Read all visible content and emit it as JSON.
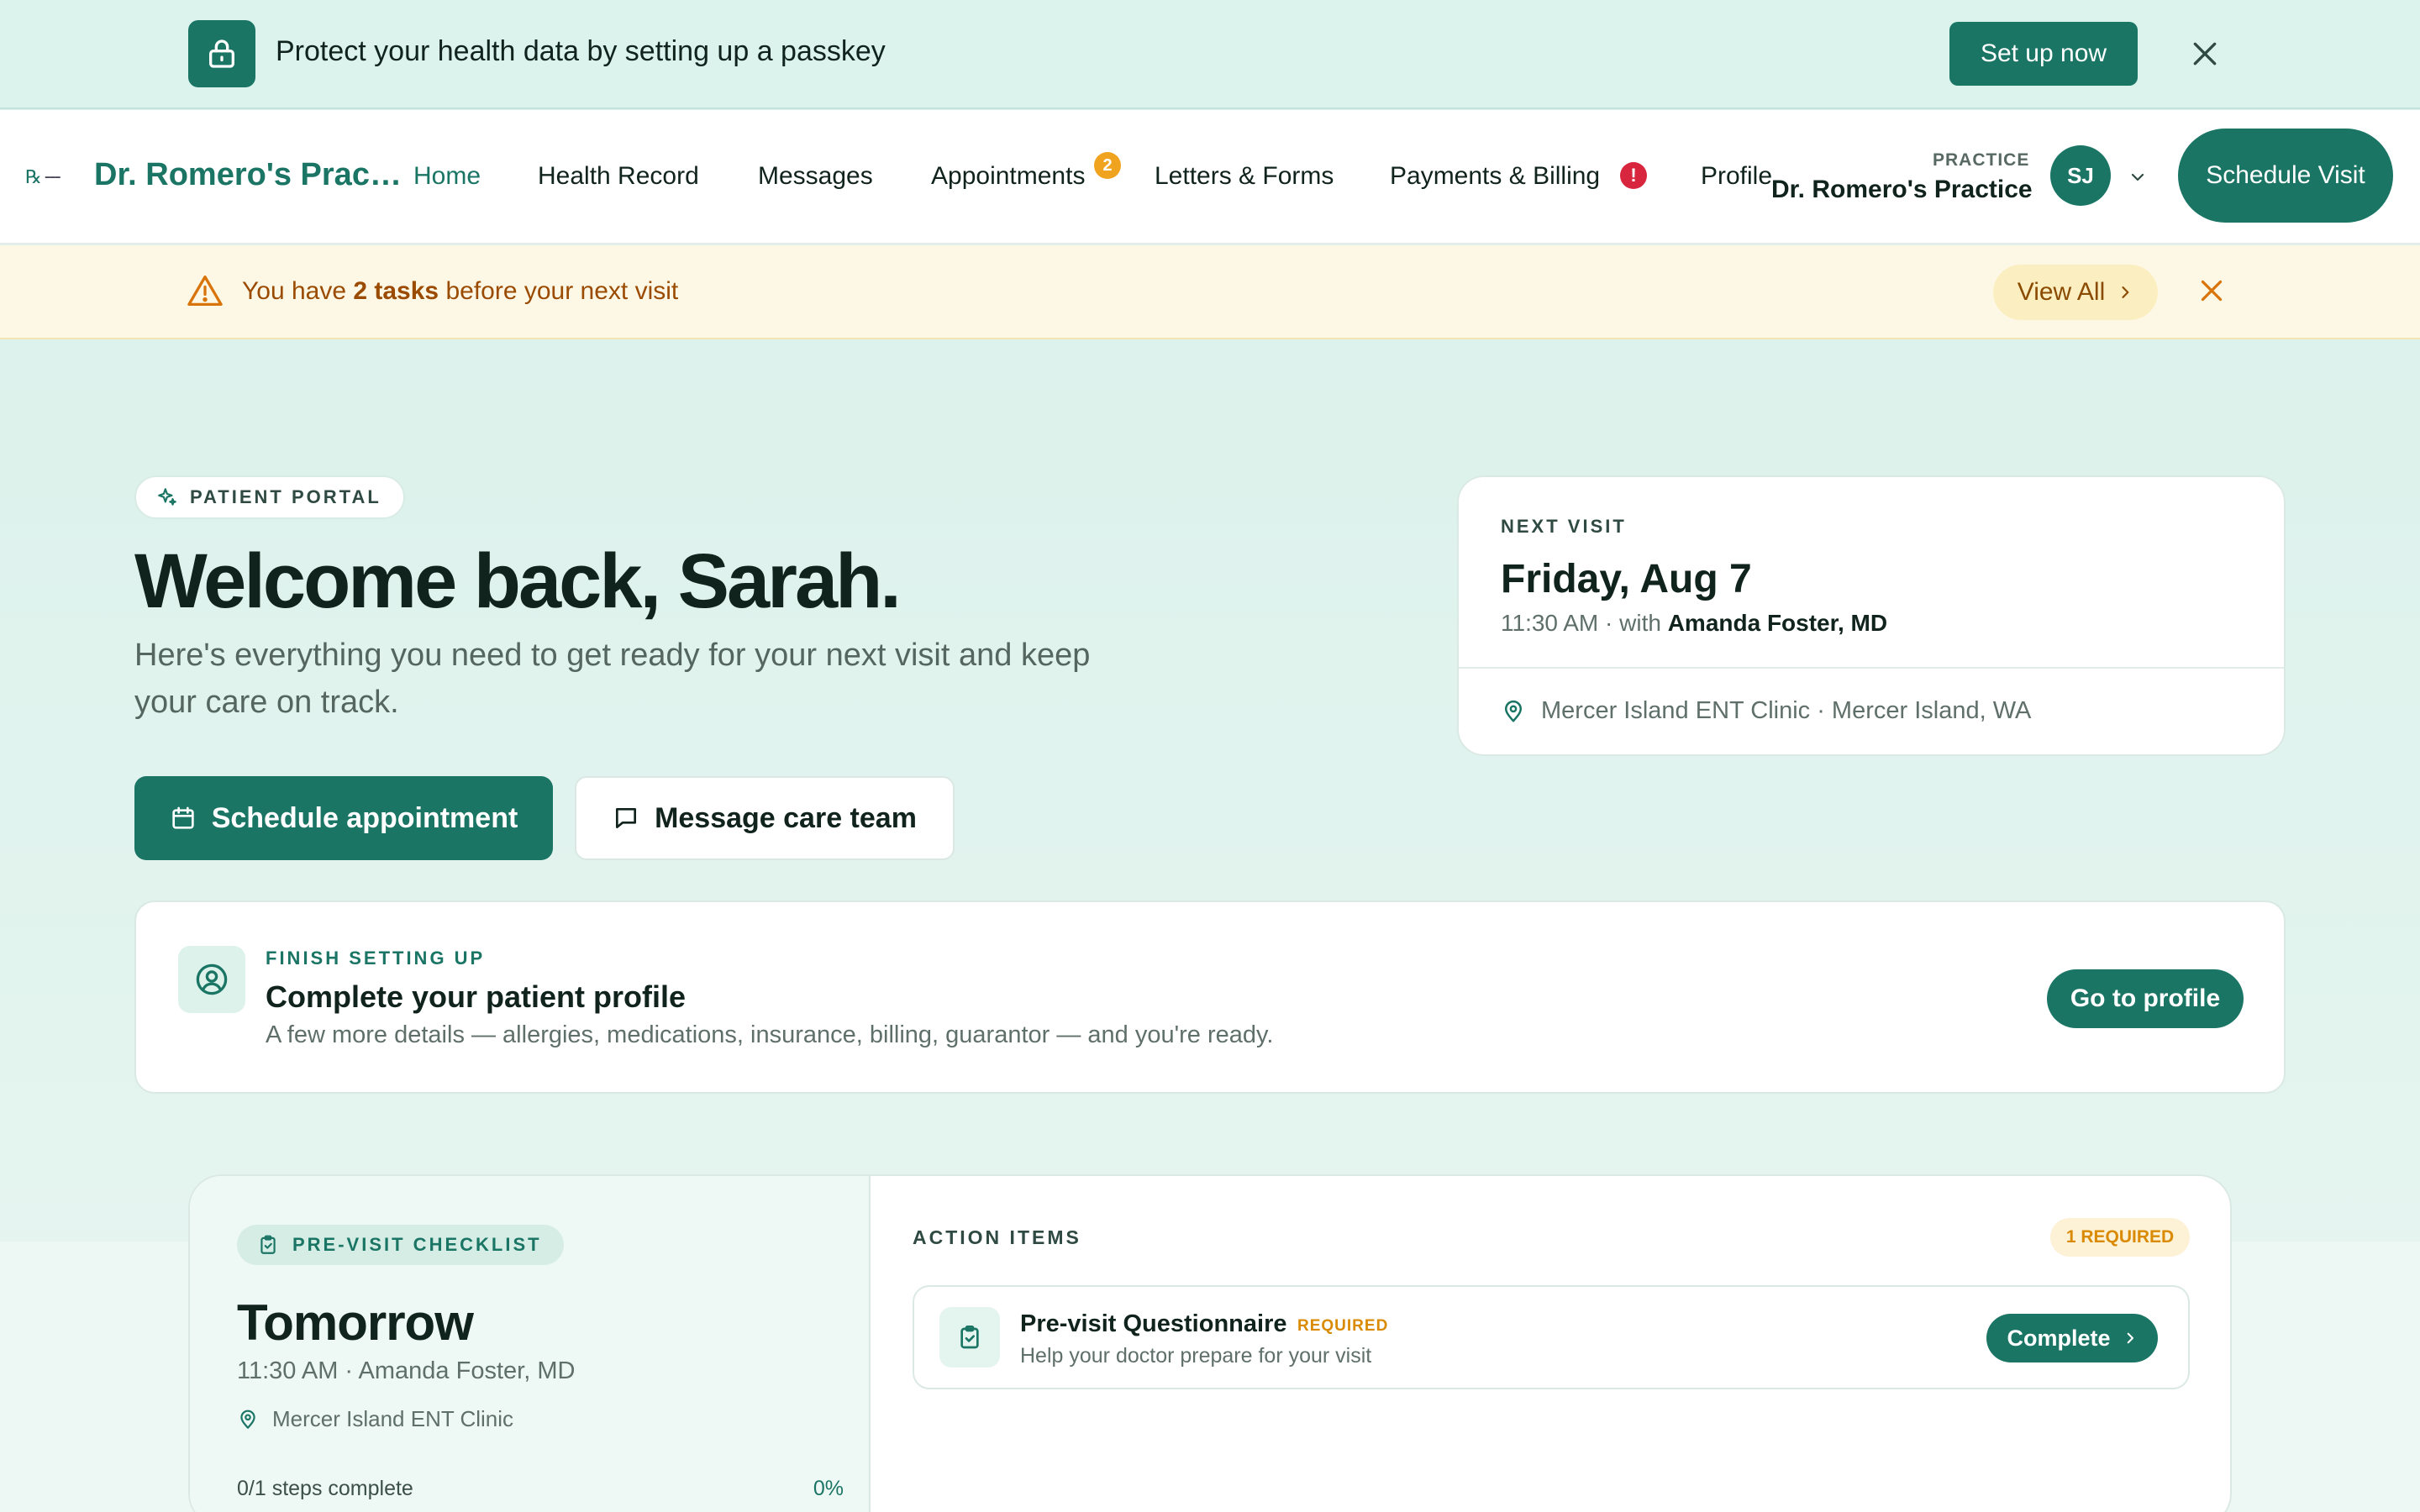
{
  "passkey_banner": {
    "message": "Protect your health data by setting up a passkey",
    "button_label": "Set up now",
    "icon": "lock-icon"
  },
  "nav": {
    "practice_title": "Dr. Romero's Practice",
    "items": [
      {
        "label": "Home",
        "active": true
      },
      {
        "label": "Health Record"
      },
      {
        "label": "Messages"
      },
      {
        "label": "Appointments",
        "badge": "2"
      },
      {
        "label": "Letters & Forms"
      },
      {
        "label": "Payments & Billing",
        "alert": "!"
      },
      {
        "label": "Profile"
      }
    ],
    "practice_label": "PRACTICE",
    "practice_name": "Dr. Romero's Practice",
    "avatar_initials": "SJ",
    "schedule_button": "Schedule Visit"
  },
  "tasks_banner": {
    "prefix": "You have ",
    "count_text": "2 tasks",
    "suffix": " before your next visit",
    "view_all_label": "View All"
  },
  "hero": {
    "chip_label": "PATIENT PORTAL",
    "welcome": "Welcome back, Sarah.",
    "subtitle": "Here's everything you need to get ready for your next visit and keep your care on track.",
    "schedule_button": "Schedule appointment",
    "message_button": "Message care team"
  },
  "next_visit": {
    "label": "NEXT VISIT",
    "date": "Friday, Aug 7",
    "time": "11:30 AM",
    "with_text": "with",
    "provider": "Amanda Foster, MD",
    "location": "Mercer Island ENT Clinic · Mercer Island, WA"
  },
  "profile_setup": {
    "eyebrow": "FINISH SETTING UP",
    "title": "Complete your patient profile",
    "description": "A few more details — allergies, medications, insurance, billing, guarantor — and you're ready.",
    "button_label": "Go to profile"
  },
  "checklist": {
    "chip_label": "PRE-VISIT CHECKLIST",
    "when": "Tomorrow",
    "time_provider": "11:30 AM · Amanda Foster, MD",
    "clinic": "Mercer Island ENT Clinic",
    "steps_text": "0/1 steps complete",
    "percent_text": "0%",
    "progress": 0
  },
  "action_items": {
    "label": "ACTION ITEMS",
    "required_chip": "1 REQUIRED",
    "items": [
      {
        "title": "Pre-visit Questionnaire",
        "tag": "REQUIRED",
        "subtitle": "Help your doctor prepare for your visit",
        "button_label": "Complete"
      }
    ]
  },
  "colors": {
    "brand": "#1a7565",
    "warning_text": "#9a4b00",
    "badge_orange": "#f0a31f",
    "alert_red": "#d7263d"
  }
}
